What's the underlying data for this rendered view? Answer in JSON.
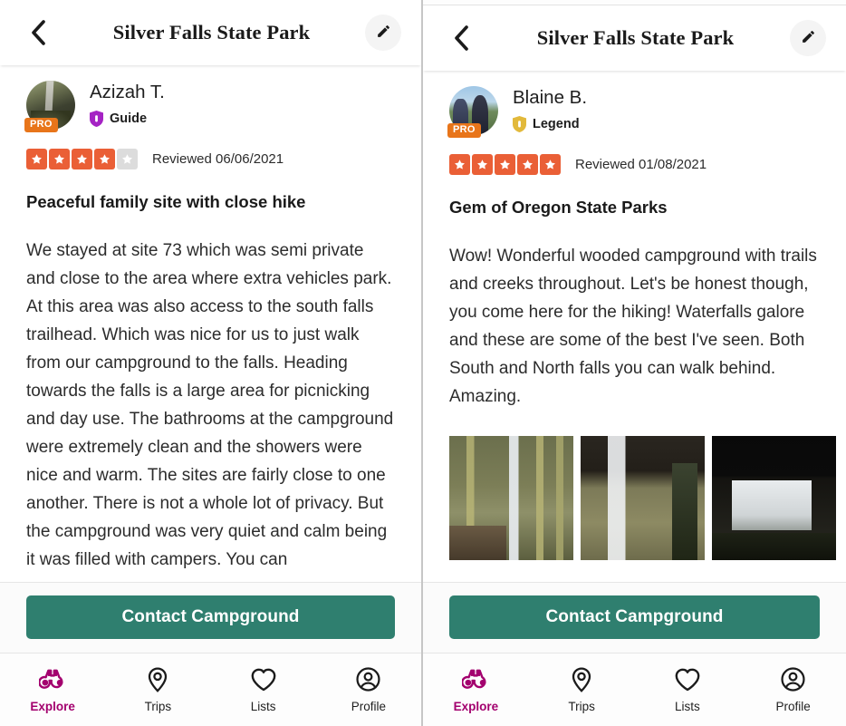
{
  "app": {
    "header": {
      "title": "Silver Falls State Park",
      "back_icon": "chevron-left-icon",
      "edit_icon": "pencil-icon"
    },
    "cta": {
      "label": "Contact Campground"
    },
    "tabbar": {
      "active_color": "#a3006e",
      "items": [
        {
          "label": "Explore",
          "icon": "binoculars-icon",
          "active": true
        },
        {
          "label": "Trips",
          "icon": "map-pin-icon",
          "active": false
        },
        {
          "label": "Lists",
          "icon": "heart-icon",
          "active": false
        },
        {
          "label": "Profile",
          "icon": "user-circle-icon",
          "active": false
        }
      ]
    },
    "colors": {
      "star_filled": "#ea5f36",
      "star_empty": "#dcdcdc",
      "pro_tag": "#e8751a",
      "cta": "#2f7f6f",
      "guide_badge": "#a523c4",
      "legend_badge": "#e2b93b"
    }
  },
  "panels": [
    {
      "id": "left",
      "reviewer": {
        "name": "Azizah T.",
        "badge_label": "Guide",
        "badge_icon": "shield-badge-icon",
        "pro_tag": "PRO",
        "avatar_alt": "avatar"
      },
      "rating": {
        "value": 4,
        "max": 5
      },
      "reviewed_on": "Reviewed 06/06/2021",
      "review_title": "Peaceful family site with close hike",
      "review_body": "We stayed at site 73 which was semi private and close to the area where extra vehicles park. At this area was also access to the south falls trailhead. Which was nice for us to just walk from our campground to the falls. Heading towards the falls is a large area for picnicking and day use. The bathrooms at the campground were extremely clean and the showers were nice and warm. The sites are fairly close to one another. There is not a whole lot of privacy. But the campground was very quiet and calm being it was filled with campers. You can",
      "photos": []
    },
    {
      "id": "right",
      "reviewer": {
        "name": "Blaine B.",
        "badge_label": "Legend",
        "badge_icon": "shield-badge-icon",
        "pro_tag": "PRO",
        "avatar_alt": "avatar"
      },
      "rating": {
        "value": 5,
        "max": 5
      },
      "reviewed_on": "Reviewed 01/08/2021",
      "review_title": "Gem of Oregon State Parks",
      "review_body": "Wow! Wonderful wooded campground with trails and creeks throughout. Let's be honest though, you come here for the hiking! Waterfalls galore and these are some of the best I've seen. Both South and North falls you can walk behind. Amazing.",
      "photos": [
        {
          "alt": "waterfall-through-mossy-trees"
        },
        {
          "alt": "waterfall-from-behind-cave"
        },
        {
          "alt": "waterfall-dark-silhouette"
        }
      ]
    }
  ]
}
